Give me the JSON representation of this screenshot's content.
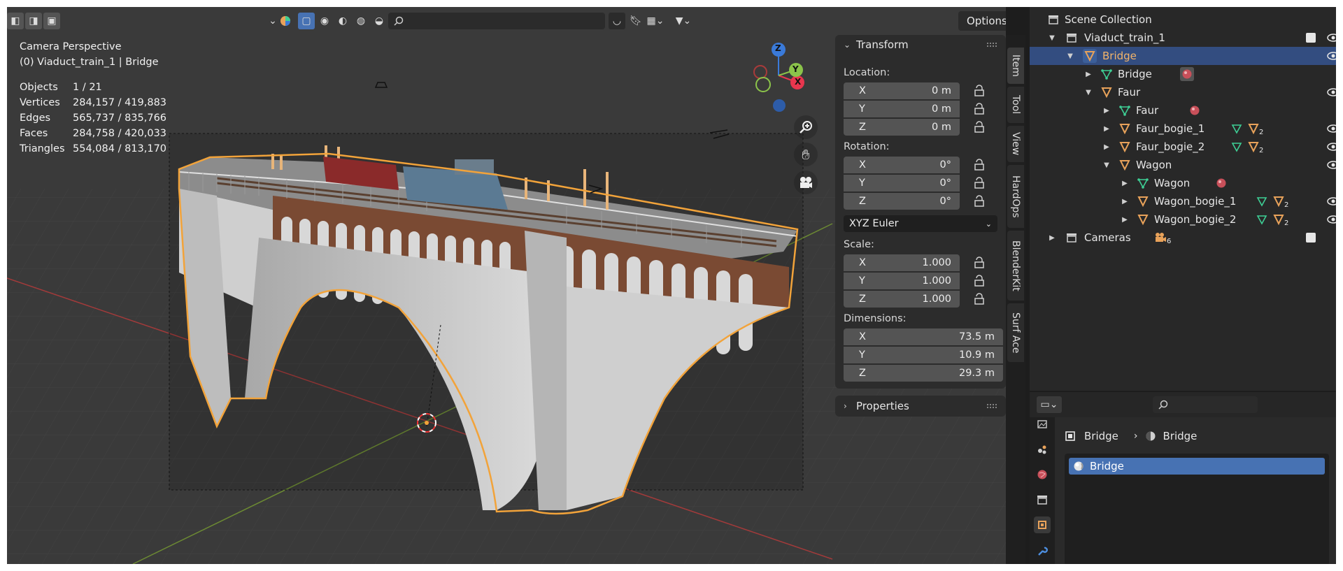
{
  "viewport": {
    "search": {
      "placeholder": ""
    },
    "options_label": "Options",
    "stats": {
      "camera": "Camera Perspective",
      "context": "(0) Viaduct_train_1 | Bridge",
      "rows": [
        {
          "label": "Objects",
          "value": "1 / 21"
        },
        {
          "label": "Vertices",
          "value": "284,157 / 419,883"
        },
        {
          "label": "Edges",
          "value": "565,737 / 835,766"
        },
        {
          "label": "Faces",
          "value": "284,758 / 420,033"
        },
        {
          "label": "Triangles",
          "value": "554,084 / 813,170"
        }
      ]
    },
    "gizmo": {
      "x": "X",
      "y": "Y",
      "z": "Z"
    }
  },
  "transform": {
    "title": "Transform",
    "location": {
      "label": "Location:",
      "x": "0 m",
      "y": "0 m",
      "z": "0 m"
    },
    "rotation": {
      "label": "Rotation:",
      "x": "0°",
      "y": "0°",
      "z": "0°",
      "mode": "XYZ Euler"
    },
    "scale": {
      "label": "Scale:",
      "x": "1.000",
      "y": "1.000",
      "z": "1.000"
    },
    "dimensions": {
      "label": "Dimensions:",
      "x": "73.5 m",
      "y": "10.9 m",
      "z": "29.3 m"
    },
    "axis": {
      "x": "X",
      "y": "Y",
      "z": "Z"
    }
  },
  "properties_panel": {
    "title": "Properties"
  },
  "side_tabs": [
    "Item",
    "Tool",
    "View",
    "HardOps",
    "BlenderKit",
    "Surf Ace"
  ],
  "outliner": {
    "rows": [
      {
        "label": "Scene Collection"
      },
      {
        "label": "Viaduct_train_1"
      },
      {
        "label": "Bridge"
      },
      {
        "label": "Bridge"
      },
      {
        "label": "Faur"
      },
      {
        "label": "Faur"
      },
      {
        "label": "Faur_bogie_1",
        "count": "2"
      },
      {
        "label": "Faur_bogie_2",
        "count": "2"
      },
      {
        "label": "Wagon"
      },
      {
        "label": "Wagon"
      },
      {
        "label": "Wagon_bogie_1",
        "count": "2"
      },
      {
        "label": "Wagon_bogie_2",
        "count": "2"
      },
      {
        "label": "Cameras",
        "count": "6"
      }
    ]
  },
  "properties": {
    "breadcrumb": {
      "object": "Bridge",
      "material": "Bridge"
    },
    "material_slot": "Bridge",
    "search": {
      "placeholder": ""
    }
  },
  "colors": {
    "selection": "#334d80",
    "active_button": "#4772b3",
    "object_orange": "#e8a25a",
    "mesh_green": "#3ecf95",
    "axis_x": "#e8364e",
    "axis_y": "#8bc34a",
    "axis_z": "#3a7ad9"
  }
}
